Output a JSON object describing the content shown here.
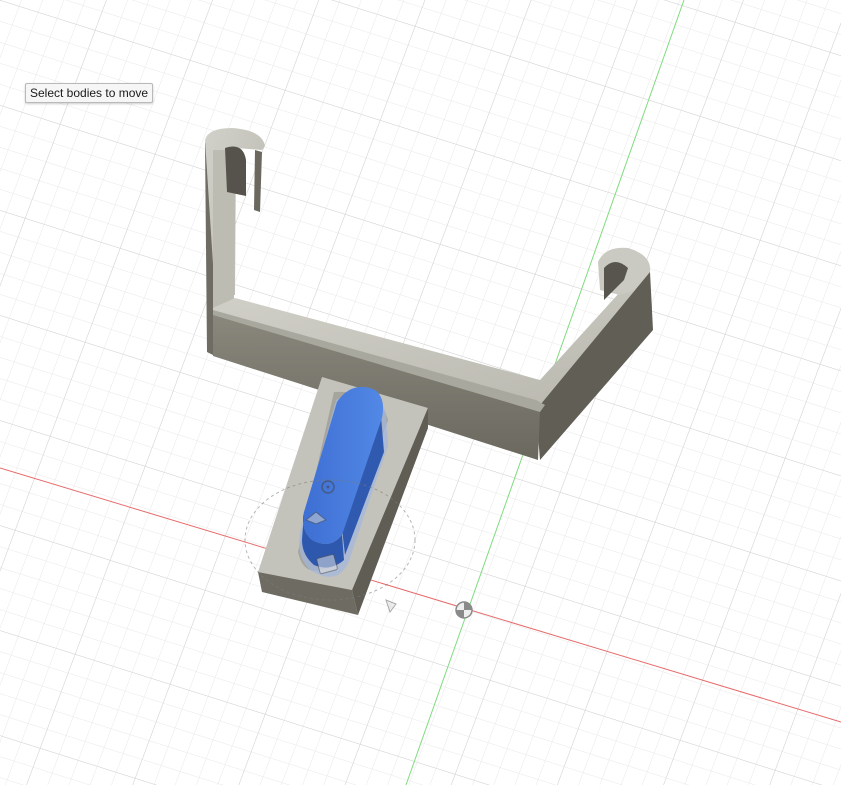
{
  "tooltip": {
    "text": "Select bodies to move"
  },
  "colors": {
    "background": "#ffffff",
    "grid_minor": "#e7e7e7",
    "grid_major": "#cfcfcf",
    "x_axis": "#e86a6a",
    "y_axis": "#7fdc7f",
    "body_top": "#c9c8bf",
    "body_front": "#7c7a6f",
    "body_side": "#5d5b52",
    "selection": "#3f73d6"
  },
  "icons": {
    "origin": "origin-icon",
    "move_arrow": "move-arrow-icon",
    "move_plane": "move-plane-icon",
    "rotate_ring": "rotate-ring-icon"
  }
}
